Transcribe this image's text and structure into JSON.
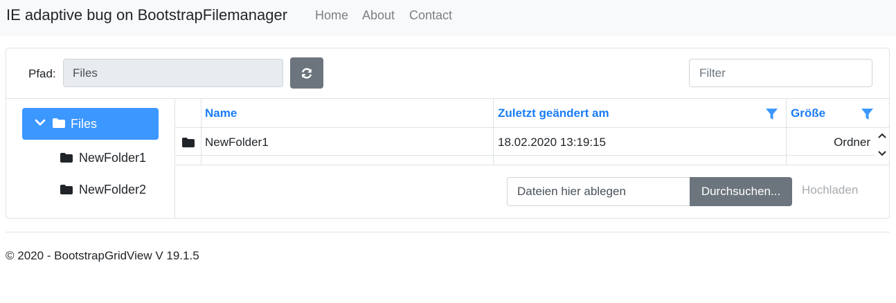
{
  "navbar": {
    "brand": "IE adaptive bug on BootstrapFilemanager",
    "links": [
      "Home",
      "About",
      "Contact"
    ]
  },
  "toolbar": {
    "path_label": "Pfad:",
    "path_value": "Files",
    "refresh_icon": "refresh-icon",
    "filter_placeholder": "Filter"
  },
  "tree": {
    "root": {
      "label": "Files",
      "expanded": true,
      "selected": true
    },
    "children": [
      {
        "label": "NewFolder1"
      },
      {
        "label": "NewFolder2"
      }
    ]
  },
  "grid": {
    "columns": [
      {
        "label": "Name",
        "filter": false
      },
      {
        "label": "Zuletzt geändert am",
        "filter": true
      },
      {
        "label": "Größe",
        "filter": true
      }
    ],
    "rows": [
      {
        "icon": "folder-icon",
        "name": "NewFolder1",
        "modified": "18.02.2020 13:19:15",
        "size": "Ordner"
      }
    ]
  },
  "upload": {
    "drop_label": "Dateien hier ablegen",
    "browse_label": "Durchsuchen...",
    "upload_label": "Hochladen"
  },
  "footer": {
    "text": "© 2020 - BootstrapGridView V 19.1.5"
  },
  "colors": {
    "accent": "#1a7cf5",
    "selected_bg": "#3c97ff",
    "button_gray": "#6c757d",
    "navbar_bg": "#f8f9fa"
  }
}
